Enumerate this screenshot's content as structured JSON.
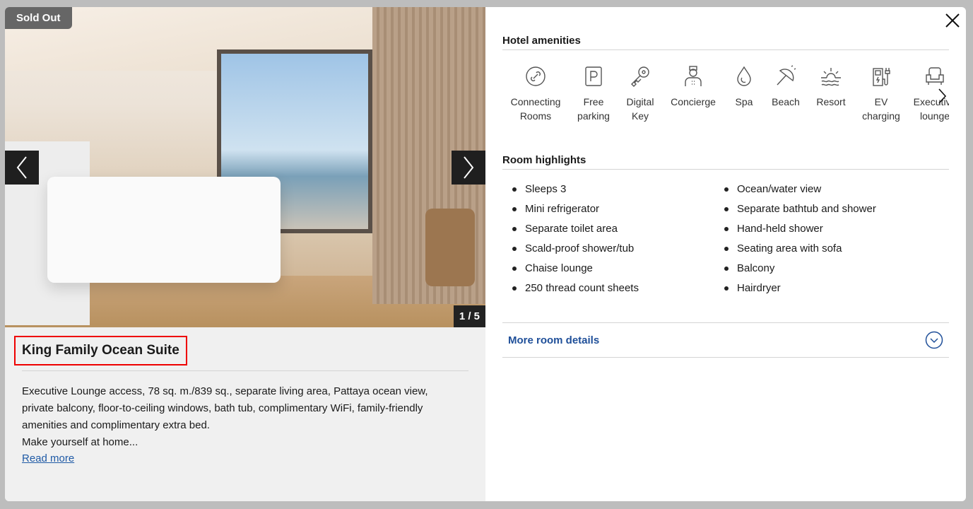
{
  "photo": {
    "sold_badge": "Sold Out",
    "counter": "1 / 5"
  },
  "room": {
    "title": "King Family Ocean Suite",
    "description_lines": [
      "Executive Lounge access, 78 sq. m./839 sq., separate living area, Pattaya ocean view,",
      "private balcony, floor-to-ceiling windows, bath tub, complimentary WiFi, family-friendly",
      "amenities and complimentary extra bed.",
      "Make yourself at home..."
    ],
    "read_more": "Read more"
  },
  "amenities": {
    "heading": "Hotel amenities",
    "items": [
      {
        "icon": "link-icon",
        "line1": "Connecting",
        "line2": "Rooms"
      },
      {
        "icon": "parking-icon",
        "line1": "Free",
        "line2": "parking"
      },
      {
        "icon": "key-icon",
        "line1": "Digital",
        "line2": "Key"
      },
      {
        "icon": "concierge-icon",
        "line1": "Concierge",
        "line2": ""
      },
      {
        "icon": "drop-icon",
        "line1": "Spa",
        "line2": ""
      },
      {
        "icon": "umbrella-icon",
        "line1": "Beach",
        "line2": ""
      },
      {
        "icon": "sunset-icon",
        "line1": "Resort",
        "line2": ""
      },
      {
        "icon": "ev-charger-icon",
        "line1": "EV",
        "line2": "charging"
      },
      {
        "icon": "armchair-icon",
        "line1": "Executive",
        "line2": "lounge"
      }
    ]
  },
  "highlights": {
    "heading": "Room highlights",
    "col1": [
      "Sleeps 3",
      "Mini refrigerator",
      "Separate toilet area",
      "Scald-proof shower/tub",
      "Chaise lounge",
      "250 thread count sheets"
    ],
    "col2": [
      "Ocean/water view",
      "Separate bathtub and shower",
      "Hand-held shower",
      "Seating area with sofa",
      "Balcony",
      "Hairdryer"
    ]
  },
  "more_details": "More room details",
  "colors": {
    "link": "#1f4f99",
    "badge": "#666666",
    "highlight_border": "#e00000"
  }
}
